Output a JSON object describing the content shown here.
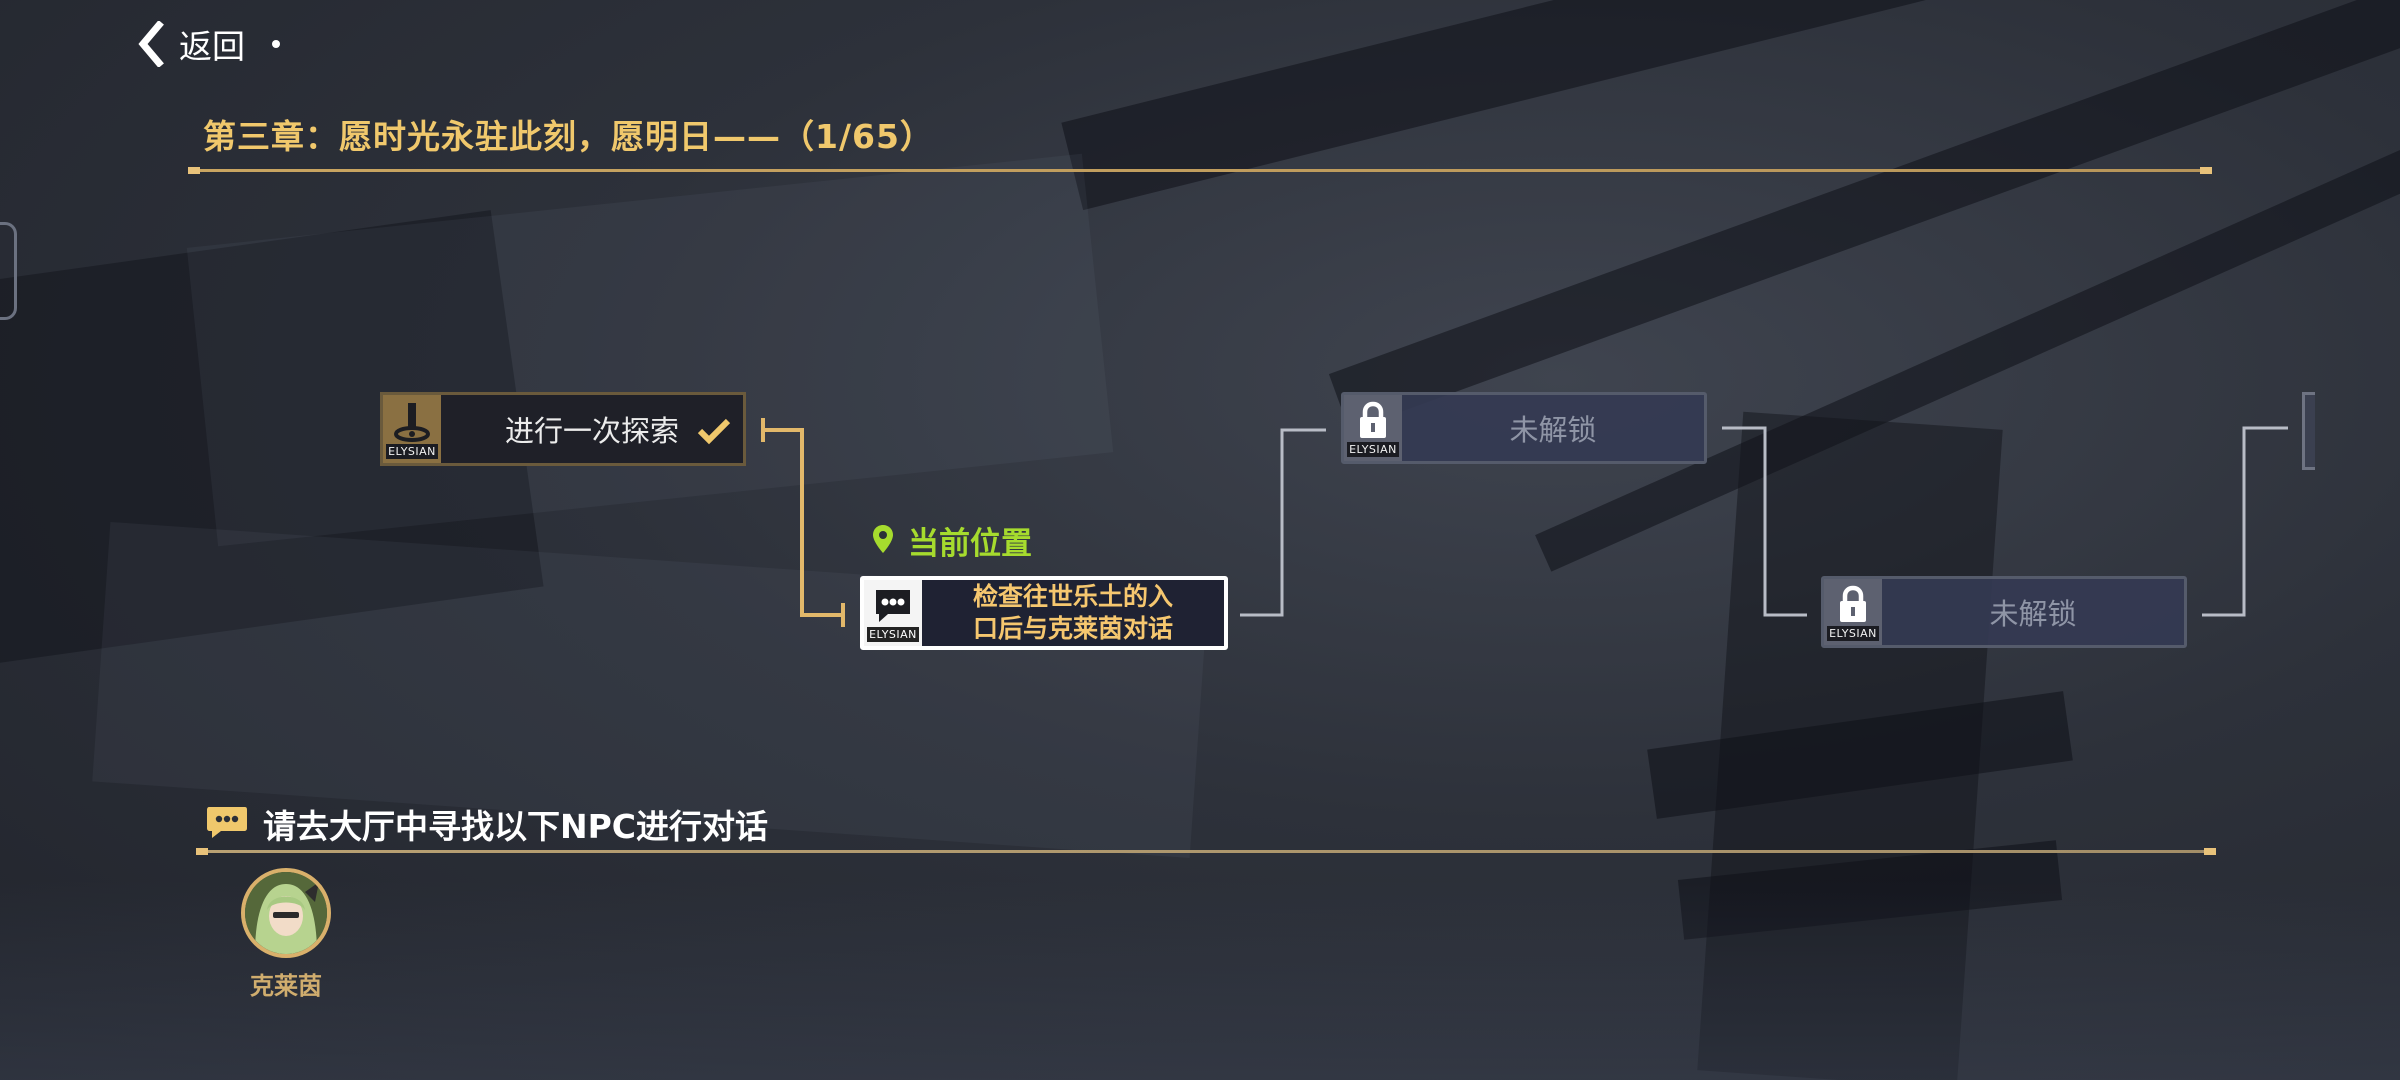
{
  "header": {
    "back_label": "返回",
    "chapter_title": "第三章：愿时光永驻此刻，愿明日——（1/65）"
  },
  "quest_map": {
    "completed_node": {
      "label": "进行一次探索",
      "tag": "ELYSIAN",
      "icon": "exclamation-icon",
      "status": "completed"
    },
    "current_marker": {
      "label": "当前位置",
      "icon": "location-pin-icon"
    },
    "current_node": {
      "label_line1": "检查往世乐土的入",
      "label_line2": "口后与克莱茵对话",
      "tag": "ELYSIAN",
      "icon": "chat-bubble-icon"
    },
    "locked_nodes": [
      {
        "label": "未解锁",
        "tag": "ELYSIAN",
        "icon": "lock-icon"
      },
      {
        "label": "未解锁",
        "tag": "ELYSIAN",
        "icon": "lock-icon"
      }
    ]
  },
  "npc_section": {
    "heading": "请去大厅中寻找以下NPC进行对话",
    "npcs": [
      {
        "name": "克莱茵"
      }
    ]
  },
  "colors": {
    "gold_accent": "#f0c86c",
    "current_green": "#a6db2e",
    "locked_text": "#8f95a6",
    "connector_gold": "#e2b86a",
    "connector_gray": "#b8bcc6"
  }
}
